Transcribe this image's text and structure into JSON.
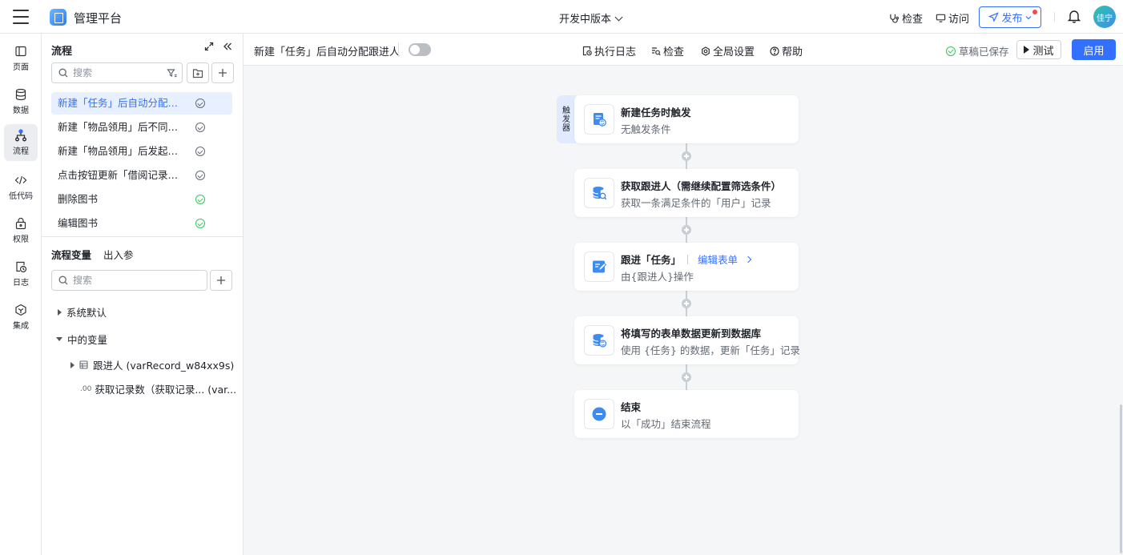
{
  "header": {
    "app_title": "管理平台",
    "version_label": "开发中版本",
    "check_label": "检查",
    "visit_label": "访问",
    "publish_label": "发布",
    "avatar_text": "佳宁"
  },
  "rail": {
    "items": [
      {
        "label": "页面",
        "icon": "page-icon"
      },
      {
        "label": "数据",
        "icon": "database-icon"
      },
      {
        "label": "流程",
        "icon": "flow-icon",
        "active": true
      },
      {
        "label": "低代码",
        "icon": "code-icon"
      },
      {
        "label": "权限",
        "icon": "lock-icon"
      },
      {
        "label": "日志",
        "icon": "log-icon"
      },
      {
        "label": "集成",
        "icon": "integration-icon"
      }
    ]
  },
  "flow_panel": {
    "title": "流程",
    "search_placeholder": "搜索",
    "flows": [
      {
        "label": "新建「任务」后自动分配跟进人",
        "status": "draft",
        "active": true
      },
      {
        "label": "新建「物品领用」后不同分类的人审批",
        "status": "draft"
      },
      {
        "label": "新建「物品领用」后发起审批",
        "status": "draft"
      },
      {
        "label": "点击按钮更新「借阅记录」状态",
        "status": "draft"
      },
      {
        "label": "删除图书",
        "status": "enabled"
      },
      {
        "label": "编辑图书",
        "status": "enabled"
      }
    ],
    "var_tabs": [
      "流程变量",
      "出入参"
    ],
    "var_search_placeholder": "搜索",
    "tree": {
      "group_default": "系统默认",
      "group_mid": "中的变量",
      "var_record": "跟进人 (varRecord_w84xx9s)",
      "var_count_prefix": ".00",
      "var_count": "获取记录数（获取记录... (var..."
    }
  },
  "canvas_header": {
    "flow_name": "新建「任务」后自动分配跟进人",
    "exec_log": "执行日志",
    "check": "检查",
    "global_settings": "全局设置",
    "help": "帮助",
    "saved": "草稿已保存",
    "test": "测试",
    "enable": "启用"
  },
  "trigger_tag": "触发器",
  "nodes": [
    {
      "title": "新建任务时触发",
      "subtitle": "无触发条件",
      "icon": "task-trigger-icon"
    },
    {
      "title": "获取跟进人（需继续配置筛选条件）",
      "subtitle": "获取一条满足条件的「用户」记录",
      "icon": "db-query-icon"
    },
    {
      "title": "跟进「任务」",
      "subtitle": "由{跟进人}操作",
      "icon": "form-edit-icon",
      "link": "编辑表单"
    },
    {
      "title": "将填写的表单数据更新到数据库",
      "subtitle": "使用 {任务} 的数据，更新「任务」记录",
      "icon": "db-update-icon"
    },
    {
      "title": "结束",
      "subtitle": "以「成功」结束流程",
      "icon": "end-icon"
    }
  ],
  "colors": {
    "accent": "#3370ff",
    "success": "#34c759",
    "canvas_bg": "#f5f6f7"
  }
}
